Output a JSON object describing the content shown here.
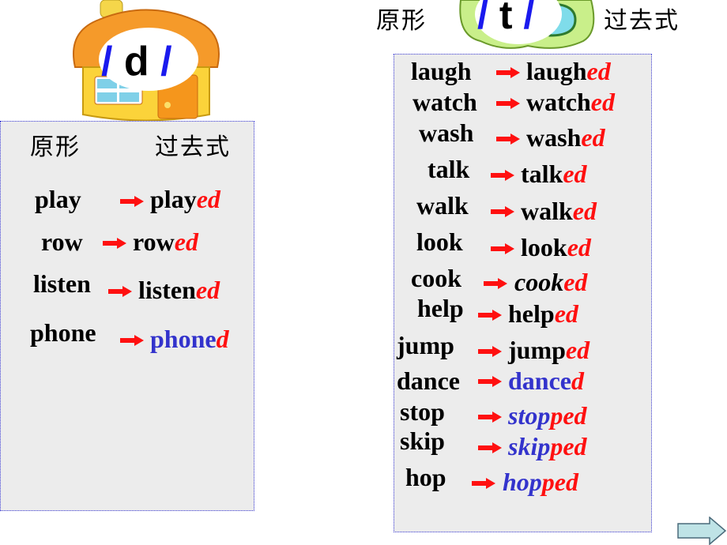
{
  "left_section": {
    "sound_label": {
      "open": "/",
      "letter": "d",
      "close": "/"
    },
    "header": {
      "base_form": "原形",
      "past_form": "过去式"
    },
    "rows": [
      {
        "base": "play",
        "stem": "play",
        "suffix": "ed",
        "stem_color": "black"
      },
      {
        "base": "row",
        "stem": "row",
        "suffix": "ed",
        "stem_color": "black"
      },
      {
        "base": "listen",
        "stem": "listen",
        "suffix": "ed",
        "stem_color": "black"
      },
      {
        "base": "phone",
        "stem": "phone",
        "suffix": "d",
        "stem_color": "blue"
      }
    ]
  },
  "right_section": {
    "sound_label": {
      "open": "/",
      "letter": "t",
      "close": "/"
    },
    "header": {
      "base_form": "原形",
      "past_form": "过去式"
    },
    "rows": [
      {
        "base": "laugh",
        "stem": "laugh",
        "suffix": "ed",
        "stem_color": "black"
      },
      {
        "base": "watch",
        "stem": "watch",
        "suffix": "ed",
        "stem_color": "black"
      },
      {
        "base": "wash",
        "stem": "wash",
        "suffix": "ed",
        "stem_color": "black"
      },
      {
        "base": "talk",
        "stem": "talk",
        "suffix": "ed",
        "stem_color": "black"
      },
      {
        "base": "walk",
        "stem": "walk",
        "suffix": "ed",
        "stem_color": "black"
      },
      {
        "base": "look",
        "stem": "look",
        "suffix": "ed",
        "stem_color": "black"
      },
      {
        "base": "cook",
        "stem": "cook",
        "suffix": "ed",
        "stem_color": "black-italic"
      },
      {
        "base": "help",
        "stem": "help",
        "suffix": "ed",
        "stem_color": "black"
      },
      {
        "base": "jump",
        "stem": "jump",
        "suffix": "ed",
        "stem_color": "black"
      },
      {
        "base": "dance",
        "stem": "dance",
        "suffix": "d",
        "stem_color": "blue"
      },
      {
        "base": "stop",
        "stem": "stop",
        "suffix": "ped",
        "stem_color": "blue-italic"
      },
      {
        "base": "skip",
        "stem": "skip",
        "suffix": "ped",
        "stem_color": "blue-italic"
      },
      {
        "base": "hop",
        "stem": "hop",
        "suffix": "ped",
        "stem_color": "blue-italic"
      }
    ]
  },
  "colors": {
    "suffix": "#ff1010",
    "highlight_stem": "#3333cc",
    "panel_bg": "#ececec",
    "arrow": "#ff1010",
    "next_button": "#bfe3e6"
  },
  "nav": {
    "next_icon": "right-arrow-icon"
  }
}
